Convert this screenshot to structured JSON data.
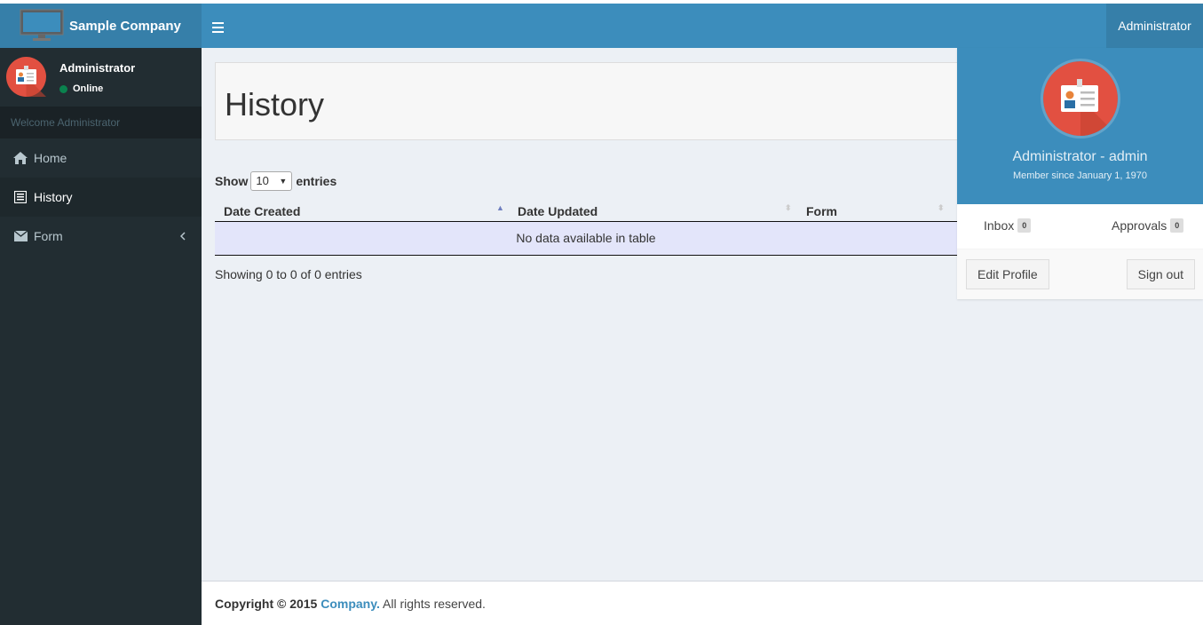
{
  "app": {
    "logo_text": "Sample Company",
    "navbar_user": "Administrator"
  },
  "sidebar": {
    "user_name": "Administrator",
    "status": "Online",
    "header": "Welcome Administrator",
    "items": [
      {
        "label": "Home",
        "icon": "home-icon"
      },
      {
        "label": "History",
        "icon": "list-icon"
      },
      {
        "label": "Form",
        "icon": "envelope-icon"
      }
    ]
  },
  "page": {
    "title": "History"
  },
  "table": {
    "show_label": "Show",
    "page_length": "10",
    "entries_label": "entries",
    "columns": [
      "Date Created",
      "Date Updated",
      "Form"
    ],
    "empty_text": "No data available in table",
    "info": "Showing 0 to 0 of 0 entries"
  },
  "user_dropdown": {
    "name": "Administrator - admin",
    "member_since": "Member since January 1, 1970",
    "inbox_label": "Inbox",
    "inbox_count": "0",
    "approvals_label": "Approvals",
    "approvals_count": "0",
    "edit_profile": "Edit Profile",
    "sign_out": "Sign out"
  },
  "footer": {
    "copyright": "Copyright © 2015",
    "company": "Company.",
    "rights": "All rights reserved."
  },
  "colors": {
    "navbar": "#3c8dbc",
    "sidebar": "#222d32",
    "avatar_red": "#e25041"
  }
}
